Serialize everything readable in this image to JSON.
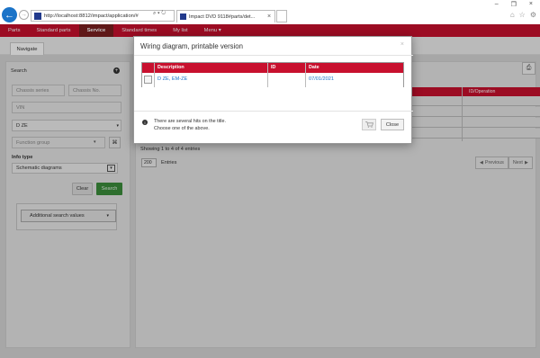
{
  "browser": {
    "url": "http://localhost:8812/impact/application/#",
    "tab_title": "Impact DVD 9118#parts/det...",
    "tab_close": "×",
    "addr_controls": "⌕ ▾ ↻",
    "win_controls": [
      "–",
      "❐",
      "×"
    ],
    "tools": [
      "⌂",
      "☆",
      "⚙"
    ]
  },
  "app_nav": {
    "items": [
      "Parts",
      "Standard parts",
      "Service",
      "Standard times",
      "My list",
      "Menu ▾"
    ],
    "active": "Service"
  },
  "subnav": {
    "tab": "Navigate"
  },
  "left_panel": {
    "search_label": "Search",
    "chassis_series_placeholder": "Chassis series",
    "chassis_no_placeholder": "Chassis No.",
    "vin_placeholder": "VIN",
    "engine_value": "D ZE",
    "function_group_placeholder": "Function group",
    "info_type_label": "Info type",
    "info_type_value": "Schematic diagrams",
    "clear_label": "Clear",
    "search_button": "Search",
    "additional_search": "Additional search values"
  },
  "right_panel": {
    "bg_header_col": "ID/Operation",
    "showing": "Showing 1 to 4 of 4 entries",
    "entries_value": "200",
    "entries_label": "Entries",
    "previous": "Previous",
    "next": "Next"
  },
  "modal": {
    "title": "Wiring diagram, printable version",
    "close_x": "×",
    "columns": [
      "Description",
      "ID",
      "Date"
    ],
    "row": {
      "description": "D ZE, EM-ZE",
      "id": "",
      "date": "07/01/2021"
    },
    "info_line1": "There are several hits on the title.",
    "info_line2": "Choose one of the above.",
    "close_button": "Close"
  }
}
